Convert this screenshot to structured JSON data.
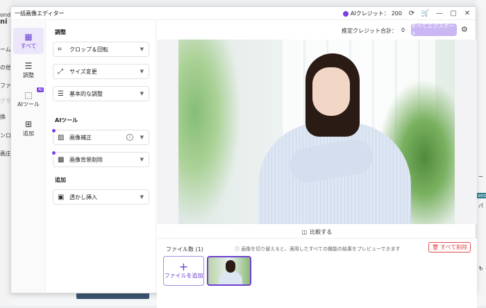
{
  "background": {
    "left_fragments": [
      "ond",
      "ni",
      "ーム",
      "の他",
      "ファ",
      "グモ",
      "換",
      "ンロ",
      "画庄"
    ],
    "right_fragments": [
      "and",
      "パ",
      "ー",
      "も"
    ]
  },
  "window": {
    "title": "一括画像エディター",
    "credits_label": "AIクレジット：",
    "credits_value": "200",
    "icons": [
      "refresh-icon",
      "cart-icon",
      "minimize-icon",
      "maximize-icon",
      "close-icon"
    ]
  },
  "sidenav": {
    "items": [
      {
        "label": "すべて",
        "icon": "grid-icon",
        "active": true
      },
      {
        "label": "調整",
        "icon": "sliders-icon",
        "active": false
      },
      {
        "label": "AIツール",
        "icon": "ai-icon",
        "active": false,
        "badge": "AI"
      },
      {
        "label": "追加",
        "icon": "plus-box-icon",
        "active": false
      }
    ]
  },
  "panel": {
    "section_adjust": "調整",
    "section_ai": "AIツール",
    "section_add": "追加",
    "tools": {
      "crop": "クロップ＆回転",
      "resize": "サイズ変更",
      "basic": "基本的な調整",
      "enhance": "画像補正",
      "bg_remove": "画像背景削除",
      "watermark": "透かし挿入"
    }
  },
  "main": {
    "estimated_label": "推定クレジット合計：",
    "estimated_value": "0",
    "export_all": "すべてエクスポート",
    "compare": "比較する",
    "file_count": "ファイル数 (1)",
    "hint": "画像を切り替えると、適用したすべての機能の結果をプレビューできます",
    "delete_all": "すべて削除",
    "add_file": "ファイルを追加"
  },
  "colors": {
    "accent": "#6a3fd0",
    "accent_light": "#c9b6f3",
    "danger": "#e04b4b"
  }
}
